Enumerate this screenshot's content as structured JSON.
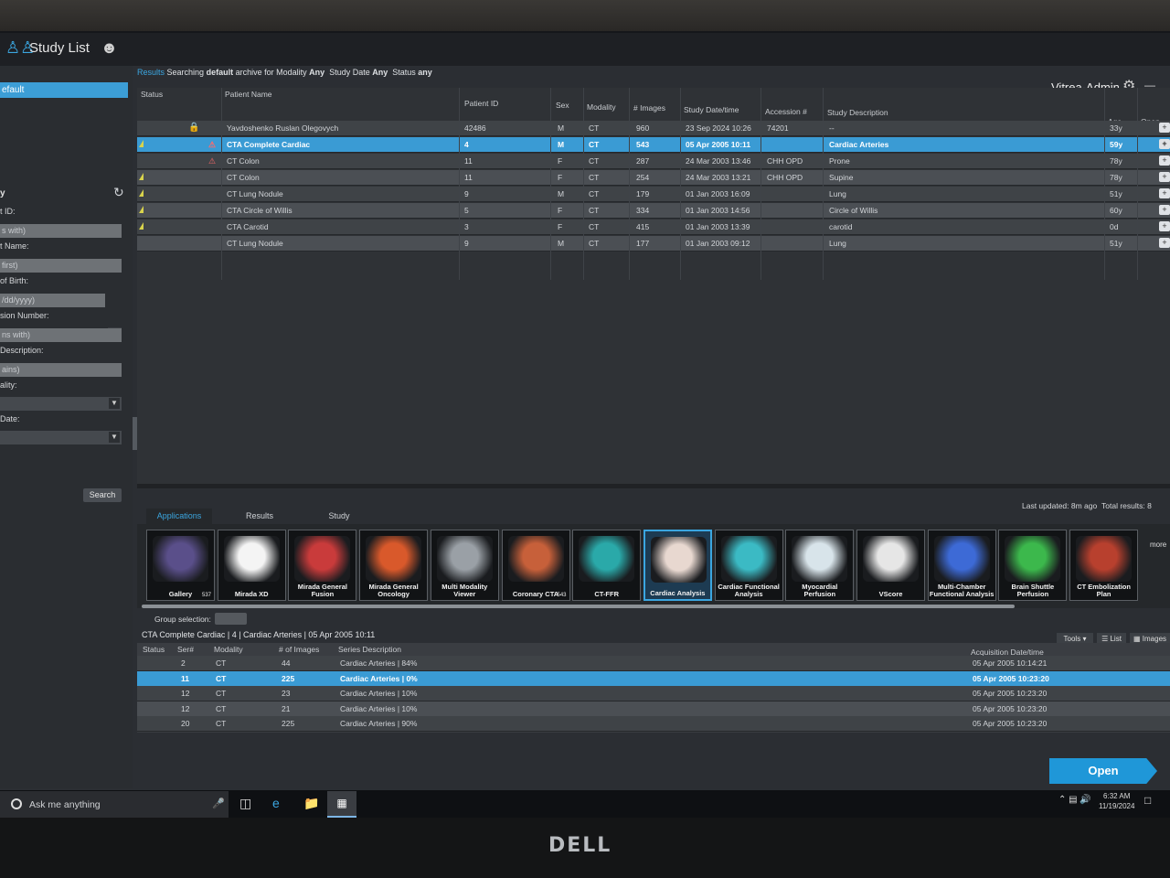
{
  "app": {
    "title": "Study List",
    "brand": "Vitrea-Admin"
  },
  "left_panel": {
    "default_item": "efault",
    "filter_title": "y",
    "fields": [
      {
        "label": "t ID:",
        "placeholder": "s with)"
      },
      {
        "label": "t Name:",
        "placeholder": "first)"
      },
      {
        "label": "of Birth:",
        "placeholder": "/dd/yyyy)"
      },
      {
        "label": "sion Number:",
        "placeholder": "ns with)"
      },
      {
        "label": "Description:",
        "placeholder": "ains)"
      }
    ],
    "selects": [
      {
        "label": "ality:"
      },
      {
        "label": "Date:"
      }
    ],
    "search_label": "Search"
  },
  "results_header": {
    "results_label": "Results",
    "searching_text": "Searching",
    "archive_word": "default",
    "archive_text": "archive for Modality",
    "modality_value": "Any",
    "study_date_label": "Study Date",
    "study_date_value": "Any",
    "status_label": "Status",
    "status_value": "any"
  },
  "study_table": {
    "columns": [
      "Status",
      "Patient Name",
      "Patient ID",
      "Sex",
      "Modality",
      "# Images",
      "Study Date/time",
      "Accession #",
      "Study Description",
      "Age",
      "Open"
    ],
    "rows": [
      {
        "name": "Yavdoshenko Ruslan Olegovych",
        "id": "42486",
        "sex": "M",
        "modality": "CT",
        "images": "960",
        "date": "23 Sep 2024 10:26",
        "accession": "74201",
        "desc": "--",
        "age": "33y",
        "flag": false,
        "lock": true,
        "warn": false
      },
      {
        "name": "CTA Complete Cardiac",
        "id": "4",
        "sex": "M",
        "modality": "CT",
        "images": "543",
        "date": "05 Apr 2005 10:11",
        "accession": "",
        "desc": "Cardiac Arteries",
        "age": "59y",
        "flag": true,
        "lock": false,
        "warn": true
      },
      {
        "name": "CT Colon",
        "id": "11",
        "sex": "F",
        "modality": "CT",
        "images": "287",
        "date": "24 Mar 2003 13:46",
        "accession": "CHH OPD",
        "desc": "Prone",
        "age": "78y",
        "flag": false,
        "lock": false,
        "warn": true
      },
      {
        "name": "CT Colon",
        "id": "11",
        "sex": "F",
        "modality": "CT",
        "images": "254",
        "date": "24 Mar 2003 13:21",
        "accession": "CHH OPD",
        "desc": "Supine",
        "age": "78y",
        "flag": true,
        "lock": false,
        "warn": false
      },
      {
        "name": "CT Lung Nodule",
        "id": "9",
        "sex": "M",
        "modality": "CT",
        "images": "179",
        "date": "01 Jan 2003 16:09",
        "accession": "",
        "desc": "Lung",
        "age": "51y",
        "flag": true,
        "lock": false,
        "warn": false
      },
      {
        "name": "CTA Circle of Willis",
        "id": "5",
        "sex": "F",
        "modality": "CT",
        "images": "334",
        "date": "01 Jan 2003 14:56",
        "accession": "",
        "desc": "Circle of Willis",
        "age": "60y",
        "flag": true,
        "lock": false,
        "warn": false
      },
      {
        "name": "CTA Carotid",
        "id": "3",
        "sex": "F",
        "modality": "CT",
        "images": "415",
        "date": "01 Jan 2003 13:39",
        "accession": "",
        "desc": "carotid",
        "age": "0d",
        "flag": true,
        "lock": false,
        "warn": false
      },
      {
        "name": "CT Lung Nodule",
        "id": "9",
        "sex": "M",
        "modality": "CT",
        "images": "177",
        "date": "01 Jan 2003 09:12",
        "accession": "",
        "desc": "Lung",
        "age": "51y",
        "flag": false,
        "lock": false,
        "warn": false
      }
    ],
    "selected_row": 1
  },
  "status_bar": {
    "last_updated": "Last updated: 8m ago",
    "total_results": "Total results: 8"
  },
  "tabs": [
    "Applications",
    "Results",
    "Study"
  ],
  "apps": [
    {
      "name": "Gallery",
      "count": "537",
      "color": "#5a4f8a"
    },
    {
      "name": "Mirada XD",
      "count": "",
      "color": "#f4f4f4"
    },
    {
      "name": "Mirada General Fusion",
      "count": "",
      "color": "#c93b3b"
    },
    {
      "name": "Mirada General Oncology",
      "count": "",
      "color": "#d9592b"
    },
    {
      "name": "Multi Modality Viewer",
      "count": "",
      "color": "#9aa0a6"
    },
    {
      "name": "Coronary CTA",
      "count": "543",
      "color": "#c7603a"
    },
    {
      "name": "CT-FFR",
      "count": "",
      "color": "#2aa9a9"
    },
    {
      "name": "Cardiac Analysis",
      "count": "",
      "color": "#e8d8d0"
    },
    {
      "name": "Cardiac Functional Analysis",
      "count": "",
      "color": "#3bbac4"
    },
    {
      "name": "Myocardial Perfusion",
      "count": "",
      "color": "#d8e4ea"
    },
    {
      "name": "VScore",
      "count": "",
      "color": "#e6e6e6"
    },
    {
      "name": "Multi-Chamber Functional Analysis",
      "count": "",
      "color": "#3d6ad6"
    },
    {
      "name": "Brain Shuttle Perfusion",
      "count": "",
      "color": "#3cb84c"
    },
    {
      "name": "CT Embolization Plan",
      "count": "",
      "color": "#b8402e"
    }
  ],
  "selected_app": 7,
  "more_label": "more",
  "group_selection_label": "Group selection:",
  "series": {
    "title": "CTA Complete Cardiac | 4 | Cardiac Arteries | 05 Apr 2005 10:11",
    "tools_label": "Tools",
    "list_label": "List",
    "images_label": "Images",
    "columns": [
      "Status",
      "Ser#",
      "Modality",
      "# of Images",
      "Series Description",
      "Acquisition Date/time"
    ],
    "rows": [
      {
        "ser": "2",
        "modality": "CT",
        "images": "44",
        "desc": "Cardiac Arteries | 84%",
        "date": "05 Apr 2005 10:14:21"
      },
      {
        "ser": "11",
        "modality": "CT",
        "images": "225",
        "desc": "Cardiac Arteries | 0%",
        "date": "05 Apr 2005 10:23:20"
      },
      {
        "ser": "12",
        "modality": "CT",
        "images": "23",
        "desc": "Cardiac Arteries | 10%",
        "date": "05 Apr 2005 10:23:20"
      },
      {
        "ser": "12",
        "modality": "CT",
        "images": "21",
        "desc": "Cardiac Arteries | 10%",
        "date": "05 Apr 2005 10:23:20"
      },
      {
        "ser": "20",
        "modality": "CT",
        "images": "225",
        "desc": "Cardiac Arteries | 90%",
        "date": "05 Apr 2005 10:23:20"
      }
    ],
    "selected_row": 1
  },
  "open_button": "Open",
  "taskbar": {
    "search_placeholder": "Ask me anything",
    "time": "6:32 AM",
    "date": "11/19/2024"
  },
  "monitor_brand": "DELL",
  "colors": {
    "accent": "#3ba6e0",
    "selection": "#3a9bd4",
    "flag": "#d8d34c"
  }
}
